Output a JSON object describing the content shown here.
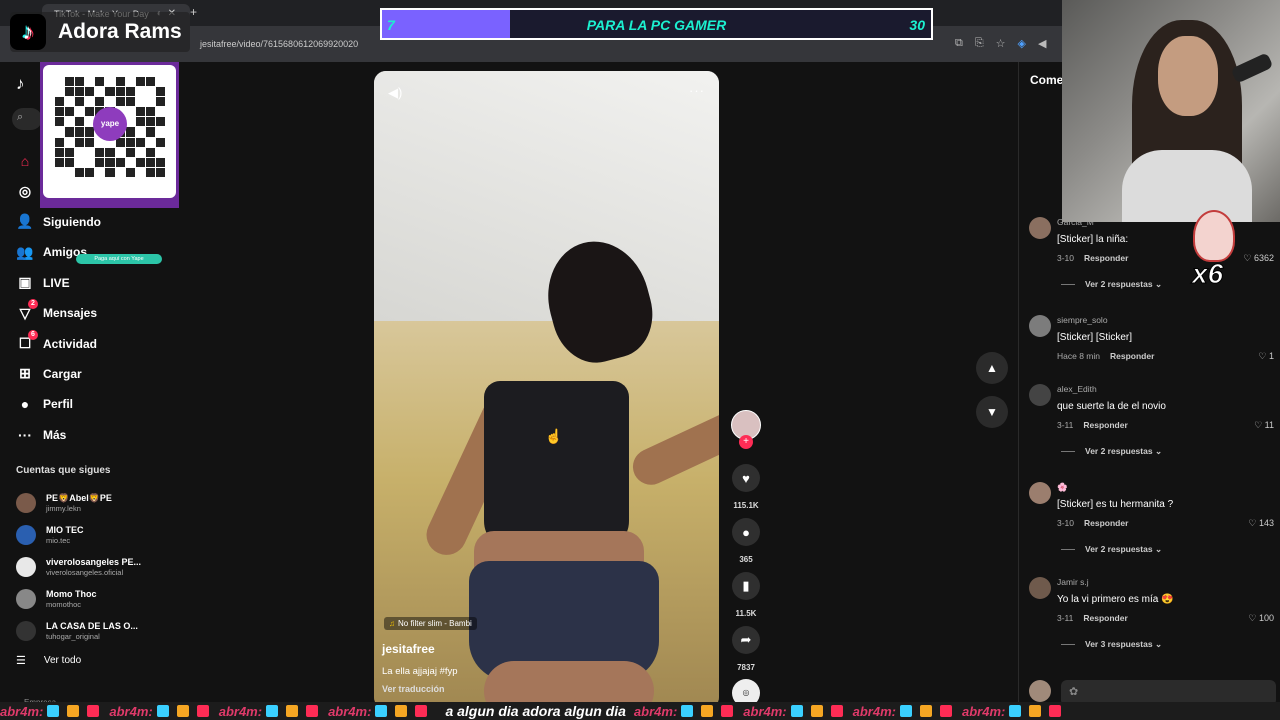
{
  "browser": {
    "tab_title": "TikTok - Make Your Day",
    "url": "jesitafree/video/7615680612069920020"
  },
  "stream": {
    "brand_name": "Adora Rams",
    "qr_caption": "Paga aquí con Yape",
    "qr_center": "yape",
    "goal": {
      "current": "7",
      "title": "PARA LA PC GAMER",
      "target": "30",
      "progress_fraction": 0.2333
    },
    "sticker_count": "x6",
    "ticker_user": "abr4m:",
    "ticker_message": "a algun dia adora algun dia"
  },
  "sidebar": {
    "logo": "TikTok",
    "nav": [
      {
        "label": "Para ti",
        "icon": "home-icon",
        "active": true,
        "badge": ""
      },
      {
        "label": "Explorar",
        "icon": "compass-icon",
        "badge": ""
      },
      {
        "label": "Siguiendo",
        "icon": "following-icon",
        "badge": ""
      },
      {
        "label": "Amigos",
        "icon": "friends-icon",
        "badge": ""
      },
      {
        "label": "LIVE",
        "icon": "live-icon",
        "badge": ""
      },
      {
        "label": "Mensajes",
        "icon": "messages-icon",
        "badge": "2"
      },
      {
        "label": "Actividad",
        "icon": "activity-icon",
        "badge": "6"
      },
      {
        "label": "Cargar",
        "icon": "upload-icon",
        "badge": ""
      },
      {
        "label": "Perfil",
        "icon": "profile-icon",
        "badge": ""
      },
      {
        "label": "Más",
        "icon": "more-icon",
        "badge": ""
      }
    ],
    "following_title": "Cuentas que sigues",
    "following": [
      {
        "name": "PE🦁Abel🦁PE",
        "username": "jimmy.lekn"
      },
      {
        "name": "MIO TEC",
        "username": "mio.tec"
      },
      {
        "name": "viverolosangeles PE...",
        "username": "viverolosangeles.oficial"
      },
      {
        "name": "Momo Thoc",
        "username": "momothoc"
      },
      {
        "name": "LA CASA DE LAS O...",
        "username": "tuhogar_original"
      }
    ],
    "see_all": "Ver todo",
    "footer": "Empresa"
  },
  "video": {
    "music": "No filter slim - Bambi",
    "username": "jesitafree",
    "caption": "La ella ajjajaj #fyp",
    "translate": "Ver traducción"
  },
  "actions": {
    "likes": "115.1K",
    "comments": "365",
    "saves": "11.5K",
    "shares": "7837"
  },
  "comments": {
    "title": "Comentarios",
    "items": [
      {
        "user": "Garcia_M",
        "text": "[Sticker] la niña:",
        "date": "3-10",
        "reply": "Responder",
        "likes": "6362",
        "replies": "Ver 2 respuestas"
      },
      {
        "user": "siempre_solo",
        "text": "[Sticker] [Sticker]",
        "date": "Hace 8 min",
        "reply": "Responder",
        "likes": "1",
        "replies": ""
      },
      {
        "user": "alex_Edith",
        "text": "que suerte la de el novio",
        "date": "3-11",
        "reply": "Responder",
        "likes": "11",
        "replies": "Ver 2 respuestas"
      },
      {
        "user": "🌸",
        "text": "[Sticker] es tu hermanita ?",
        "date": "3-10",
        "reply": "Responder",
        "likes": "143",
        "replies": "Ver 2 respuestas"
      },
      {
        "user": "Jamir s.j",
        "text": "Yo la vi primero es mía 😍",
        "date": "3-11",
        "reply": "Responder",
        "likes": "100",
        "replies": "Ver 3 respuestas"
      }
    ]
  }
}
